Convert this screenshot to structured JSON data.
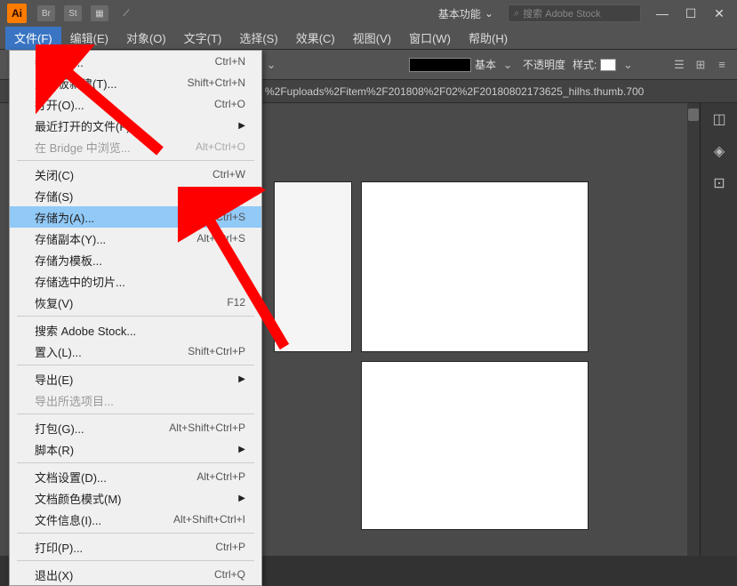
{
  "titleBar": {
    "logo": "Ai",
    "icons": [
      "Br",
      "St"
    ],
    "workspace": "基本功能",
    "searchPlaceholder": "搜索 Adobe Stock"
  },
  "menuBar": {
    "items": [
      "文件(F)",
      "编辑(E)",
      "对象(O)",
      "文字(T)",
      "选择(S)",
      "效果(C)",
      "视图(V)",
      "窗口(W)",
      "帮助(H)"
    ]
  },
  "optionsBar": {
    "strokeLabel": "基本",
    "opacityLabel": "不透明度",
    "styleLabel": "样式:"
  },
  "tabBar": {
    "text": "%2Fuploads%2Fitem%2F201808%2F02%2F20180802173625_hilhs.thumb.700"
  },
  "fileMenu": {
    "items": [
      {
        "label": "新建(N)...",
        "shortcut": "Ctrl+N",
        "type": "item"
      },
      {
        "label": "从模板新建(T)...",
        "shortcut": "Shift+Ctrl+N",
        "type": "item"
      },
      {
        "label": "打开(O)...",
        "shortcut": "Ctrl+O",
        "type": "item"
      },
      {
        "label": "最近打开的文件(F)",
        "shortcut": "",
        "type": "submenu"
      },
      {
        "label": "在 Bridge 中浏览...",
        "shortcut": "Alt+Ctrl+O",
        "type": "item",
        "disabled": true
      },
      {
        "type": "sep"
      },
      {
        "label": "关闭(C)",
        "shortcut": "Ctrl+W",
        "type": "item"
      },
      {
        "label": "存储(S)",
        "shortcut": "Ctrl+S",
        "type": "item"
      },
      {
        "label": "存储为(A)...",
        "shortcut": "Shift+Ctrl+S",
        "type": "item",
        "highlighted": true
      },
      {
        "label": "存储副本(Y)...",
        "shortcut": "Alt+Ctrl+S",
        "type": "item"
      },
      {
        "label": "存储为模板...",
        "shortcut": "",
        "type": "item"
      },
      {
        "label": "存储选中的切片...",
        "shortcut": "",
        "type": "item"
      },
      {
        "label": "恢复(V)",
        "shortcut": "F12",
        "type": "item"
      },
      {
        "type": "sep"
      },
      {
        "label": "搜索 Adobe Stock...",
        "shortcut": "",
        "type": "item"
      },
      {
        "label": "置入(L)...",
        "shortcut": "Shift+Ctrl+P",
        "type": "item"
      },
      {
        "type": "sep"
      },
      {
        "label": "导出(E)",
        "shortcut": "",
        "type": "submenu"
      },
      {
        "label": "导出所选项目...",
        "shortcut": "",
        "type": "item",
        "disabled": true
      },
      {
        "type": "sep"
      },
      {
        "label": "打包(G)...",
        "shortcut": "Alt+Shift+Ctrl+P",
        "type": "item"
      },
      {
        "label": "脚本(R)",
        "shortcut": "",
        "type": "submenu"
      },
      {
        "type": "sep"
      },
      {
        "label": "文档设置(D)...",
        "shortcut": "Alt+Ctrl+P",
        "type": "item"
      },
      {
        "label": "文档颜色模式(M)",
        "shortcut": "",
        "type": "submenu"
      },
      {
        "label": "文件信息(I)...",
        "shortcut": "Alt+Shift+Ctrl+I",
        "type": "item"
      },
      {
        "type": "sep"
      },
      {
        "label": "打印(P)...",
        "shortcut": "Ctrl+P",
        "type": "item"
      },
      {
        "type": "sep"
      },
      {
        "label": "退出(X)",
        "shortcut": "Ctrl+Q",
        "type": "item"
      }
    ]
  }
}
